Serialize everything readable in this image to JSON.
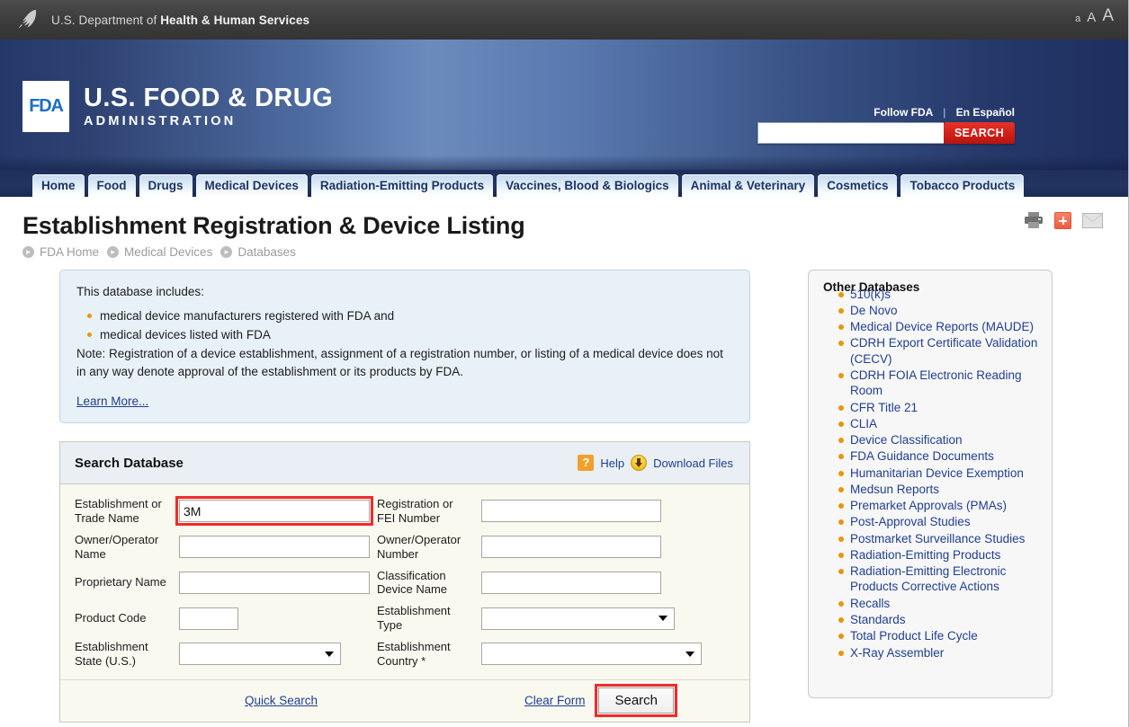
{
  "hhs_bar": {
    "text_prefix": "U.S. Department of ",
    "text_bold": "Health & Human Services",
    "logo_icon": "hhs-eagle-icon",
    "font_sizes": [
      "a",
      "A",
      "A"
    ]
  },
  "banner": {
    "logo_text": "FDA",
    "title_line1": "U.S. FOOD & DRUG",
    "title_line2": "ADMINISTRATION",
    "follow_link": "Follow FDA",
    "separator": "|",
    "espanol_link": "En Español",
    "search_value": "",
    "search_placeholder": "",
    "search_button": "SEARCH"
  },
  "nav": {
    "tabs": [
      {
        "label": "Home",
        "active": false
      },
      {
        "label": "Food",
        "active": false
      },
      {
        "label": "Drugs",
        "active": false
      },
      {
        "label": "Medical Devices",
        "active": true
      },
      {
        "label": "Radiation-Emitting Products",
        "active": false
      },
      {
        "label": "Vaccines, Blood & Biologics",
        "active": false
      },
      {
        "label": "Animal & Veterinary",
        "active": false
      },
      {
        "label": "Cosmetics",
        "active": false
      },
      {
        "label": "Tobacco Products",
        "active": false
      }
    ]
  },
  "page": {
    "title": "Establishment Registration & Device Listing",
    "breadcrumb": [
      "FDA Home",
      "Medical Devices",
      "Databases"
    ],
    "tool_icons": [
      "print-icon",
      "share-icon",
      "email-icon"
    ]
  },
  "info_box": {
    "intro": "This database includes:",
    "bullets": [
      "medical device manufacturers registered with FDA and",
      "medical devices listed with FDA"
    ],
    "note": "Note: Registration of a device establishment, assignment of a registration number, or listing of a medical device does not in any way denote approval of the establishment or its products by FDA.",
    "learn_more": "Learn More..."
  },
  "search_panel": {
    "title": "Search Database",
    "help_label": "Help",
    "help_icon_glyph": "?",
    "download_label": "Download Files",
    "fields": {
      "establishment_name": {
        "label": "Establishment or Trade Name",
        "value": "3M",
        "highlighted": true
      },
      "registration_number": {
        "label": "Registration or FEI Number",
        "value": ""
      },
      "owner_operator_name": {
        "label": "Owner/Operator Name",
        "value": ""
      },
      "owner_operator_number": {
        "label": "Owner/Operator Number",
        "value": ""
      },
      "proprietary_name": {
        "label": "Proprietary Name",
        "value": ""
      },
      "classification_device_name": {
        "label": "Classification Device Name",
        "value": ""
      },
      "product_code": {
        "label": "Product Code",
        "value": ""
      },
      "establishment_type": {
        "label": "Establishment Type",
        "value": ""
      },
      "establishment_state": {
        "label": "Establishment State (U.S.)",
        "value": ""
      },
      "establishment_country": {
        "label": "Establishment Country *",
        "value": ""
      }
    },
    "quick_search": "Quick Search",
    "clear_form": "Clear Form",
    "search_button": "Search",
    "search_button_highlighted": true
  },
  "other_databases": {
    "title": "Other Databases",
    "items": [
      "510(k)s",
      "De Novo",
      "Medical Device Reports (MAUDE)",
      "CDRH Export Certificate Validation (CECV)",
      "CDRH FOIA Electronic Reading Room",
      "CFR Title 21",
      "CLIA",
      "Device Classification",
      "FDA Guidance Documents",
      "Humanitarian Device Exemption",
      "Medsun Reports",
      "Premarket Approvals (PMAs)",
      "Post-Approval Studies",
      "Postmarket Surveillance Studies",
      "Radiation-Emitting Products",
      "Radiation-Emitting Electronic Products Corrective Actions",
      "Recalls",
      "Standards",
      "Total Product Life Cycle",
      "X-Ray Assembler"
    ]
  },
  "colors": {
    "hhs_bar": "#3e3e3e",
    "banner_dark": "#25386a",
    "banner_light": "#6b8bbd",
    "link": "#1f3f8f",
    "bullet_orange": "#e8950d",
    "highlight_red": "#ef2b2b",
    "search_red": "#cf1f17",
    "panel_cream": "#f9f9f0",
    "info_blue": "#e9f1f8"
  }
}
